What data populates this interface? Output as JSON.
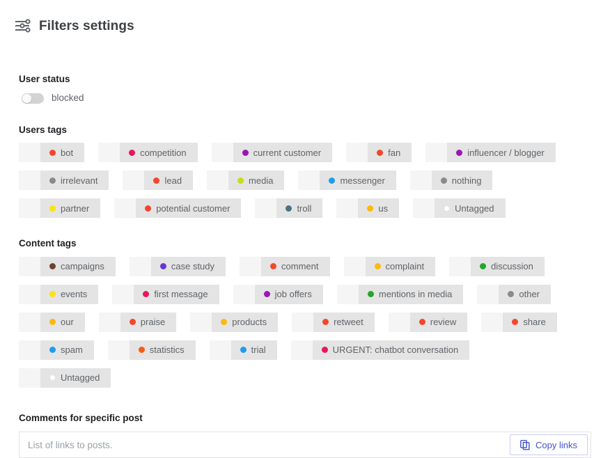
{
  "header": {
    "icon": "filter-sliders-icon",
    "title": "Filters settings"
  },
  "user_status": {
    "label": "User status",
    "toggle": {
      "label": "blocked",
      "state": "off"
    }
  },
  "users_tags": {
    "label": "Users tags",
    "rows": [
      [
        {
          "label": "bot",
          "color": "#f4462c"
        },
        {
          "label": "competition",
          "color": "#ec1558"
        },
        {
          "label": "current customer",
          "color": "#9c16b5"
        },
        {
          "label": "fan",
          "color": "#f4462c"
        },
        {
          "label": "influencer / blogger",
          "color": "#9c16b5"
        }
      ],
      [
        {
          "label": "irrelevant",
          "color": "#8a8a8a"
        },
        {
          "label": "lead",
          "color": "#f4462c"
        },
        {
          "label": "media",
          "color": "#cada1e"
        },
        {
          "label": "messenger",
          "color": "#1e9ded"
        },
        {
          "label": "nothing",
          "color": "#8a8a8a"
        }
      ],
      [
        {
          "label": "partner",
          "color": "#fbe216"
        },
        {
          "label": "potential customer",
          "color": "#f4462c"
        },
        {
          "label": "troll",
          "color": "#4c7180"
        },
        {
          "label": "us",
          "color": "#fdb90b"
        },
        {
          "label": "Untagged",
          "color": "#ffffff"
        }
      ]
    ]
  },
  "content_tags": {
    "label": "Content tags",
    "rows": [
      [
        {
          "label": "campaigns",
          "color": "#6c4231"
        },
        {
          "label": "case study",
          "color": "#6a35d8"
        },
        {
          "label": "comment",
          "color": "#f4462c"
        },
        {
          "label": "complaint",
          "color": "#fdb90b"
        },
        {
          "label": "discussion",
          "color": "#22a72a"
        }
      ],
      [
        {
          "label": "events",
          "color": "#fbe216"
        },
        {
          "label": "first message",
          "color": "#ec1558"
        },
        {
          "label": "job offers",
          "color": "#9c16b5"
        },
        {
          "label": "mentions in media",
          "color": "#22a72a"
        },
        {
          "label": "other",
          "color": "#8a8a8a"
        }
      ],
      [
        {
          "label": "our",
          "color": "#fdb90b"
        },
        {
          "label": "praise",
          "color": "#f4462c"
        },
        {
          "label": "products",
          "color": "#fdb90b"
        },
        {
          "label": "retweet",
          "color": "#f4462c"
        },
        {
          "label": "review",
          "color": "#f4462c"
        },
        {
          "label": "share",
          "color": "#f4462c"
        }
      ],
      [
        {
          "label": "spam",
          "color": "#1e9ded"
        },
        {
          "label": "statistics",
          "color": "#fa5a18"
        },
        {
          "label": "trial",
          "color": "#1e9ded"
        },
        {
          "label": "URGENT: chatbot conversation",
          "color": "#ec1558"
        }
      ],
      [
        {
          "label": "Untagged",
          "color": "#ffffff"
        }
      ]
    ]
  },
  "comments": {
    "label": "Comments for specific post",
    "input": {
      "value": "",
      "placeholder": "List of links to posts."
    },
    "copy_button": {
      "label": "Copy links",
      "icon": "copy-icon",
      "color": "#4253c5"
    }
  }
}
